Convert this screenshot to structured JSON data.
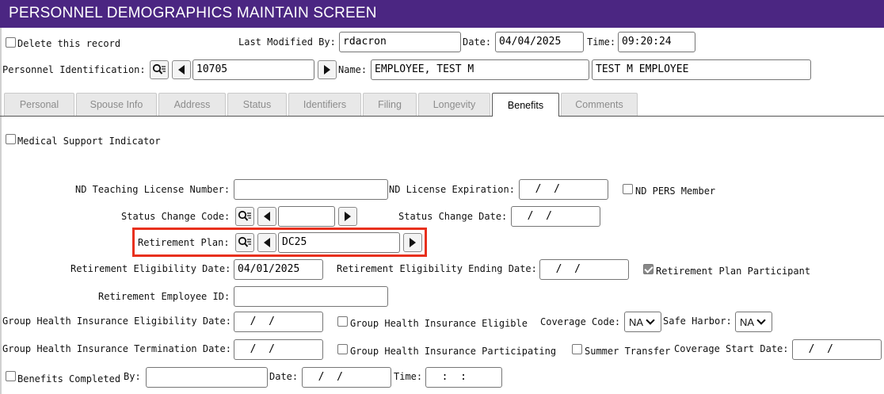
{
  "header": {
    "title": "PERSONNEL DEMOGRAPHICS MAINTAIN SCREEN"
  },
  "top": {
    "delete_label": "Delete this record",
    "last_modified_label": "Last Modified By:",
    "last_modified_value": "rdacron",
    "date_label": "Date:",
    "date_value": "04/04/2025",
    "time_label": "Time:",
    "time_value": "09:20:24",
    "personnel_id_label": "Personnel Identification:",
    "personnel_id_value": "10705",
    "name_label": "Name:",
    "name_value": "EMPLOYEE, TEST M",
    "name_display_value": "TEST M EMPLOYEE"
  },
  "tabs": [
    {
      "label": "Personal"
    },
    {
      "label": "Spouse Info"
    },
    {
      "label": "Address"
    },
    {
      "label": "Status"
    },
    {
      "label": "Identifiers"
    },
    {
      "label": "Filing"
    },
    {
      "label": "Longevity"
    },
    {
      "label": "Benefits"
    },
    {
      "label": "Comments"
    }
  ],
  "active_tab": "Benefits",
  "benefits": {
    "medical_support_label": "Medical Support Indicator",
    "nd_teaching_license_label": "ND Teaching License Number:",
    "nd_teaching_license_value": "",
    "nd_license_exp_label": "ND License Expiration:",
    "nd_license_exp_value": "  /  /",
    "nd_pers_member_label": "ND PERS Member",
    "status_change_code_label": "Status Change Code:",
    "status_change_code_value": "",
    "status_change_date_label": "Status Change Date:",
    "status_change_date_value": "  /  /",
    "retirement_plan_label": "Retirement Plan:",
    "retirement_plan_value": "DC25",
    "retirement_elig_date_label": "Retirement Eligibility Date:",
    "retirement_elig_date_value": "04/01/2025",
    "retirement_elig_end_label": "Retirement Eligibility Ending Date:",
    "retirement_elig_end_value": "  /  /",
    "retirement_participant_label": "Retirement Plan Participant",
    "retirement_participant_checked": true,
    "retirement_emp_id_label": "Retirement Employee ID:",
    "retirement_emp_id_value": "",
    "ghi_elig_date_label": "Group Health Insurance Eligibility Date:",
    "ghi_elig_date_value": "  /  /",
    "ghi_eligible_label": "Group Health Insurance Eligible",
    "coverage_code_label": "Coverage Code:",
    "coverage_code_value": "NA",
    "safe_harbor_label": "Safe Harbor:",
    "safe_harbor_value": "NA",
    "ghi_term_date_label": "Group Health Insurance Termination Date:",
    "ghi_term_date_value": "  /  /",
    "ghi_participating_label": "Group Health Insurance Participating",
    "summer_transfer_label": "Summer Transfer",
    "coverage_start_label": "Coverage Start Date:",
    "coverage_start_value": "  /  /",
    "benefits_completed_label": "Benefits Completed",
    "by_label": "By:",
    "by_value": "",
    "bc_date_label": "Date:",
    "bc_date_value": "  /  /",
    "bc_time_label": "Time:",
    "bc_time_value": "  :  :"
  },
  "colors": {
    "header_bg": "#4b2682",
    "highlight": "#e8301d"
  }
}
